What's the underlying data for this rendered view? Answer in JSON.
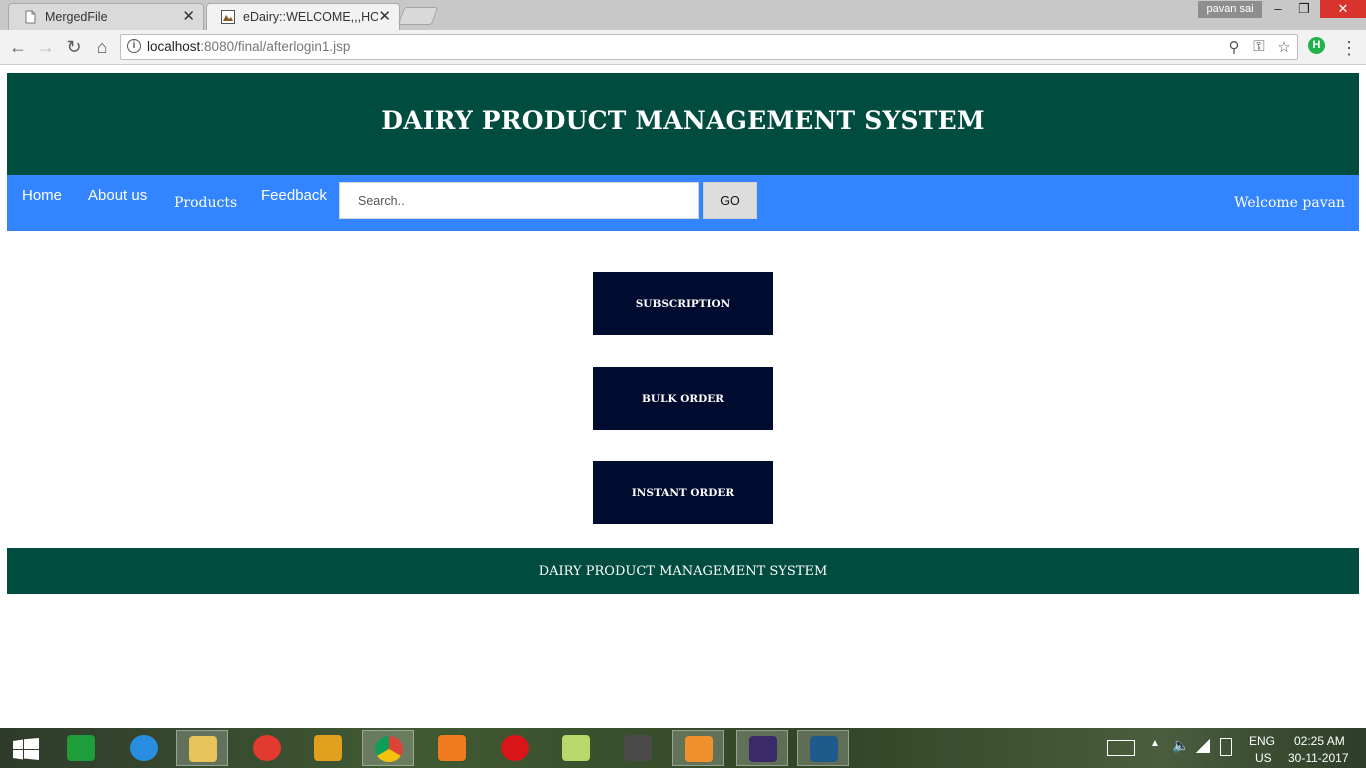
{
  "browser": {
    "tabs": [
      {
        "title": "MergedFile",
        "active": false
      },
      {
        "title": "eDairy::WELCOME,,,HOME",
        "active": true
      }
    ],
    "profile_name": "pavan sai",
    "url_host": "localhost",
    "url_path": ":8080/final/afterlogin1.jsp",
    "window_controls": {
      "minimize": "–",
      "restore": "❐",
      "close": "✕"
    },
    "icons": {
      "back": "←",
      "forward": "→",
      "reload": "↻",
      "home": "⌂",
      "zoom": "⚲",
      "key": "⚿",
      "star": "☆",
      "ext": "H",
      "menu": "⋮"
    }
  },
  "header": {
    "title": "DAIRY PRODUCT MANAGEMENT SYSTEM"
  },
  "nav": {
    "home": "Home",
    "about": "About us",
    "products": "Products",
    "feedback": "Feedback",
    "search_placeholder": "Search..",
    "go_label": "GO",
    "welcome": "Welcome pavan"
  },
  "actions": {
    "subscription": "SUBSCRIPTION",
    "bulk_order": "BULK ORDER",
    "instant_order": "INSTANT ORDER"
  },
  "footer": {
    "text": "DAIRY PRODUCT MANAGEMENT SYSTEM"
  },
  "taskbar": {
    "language_top": "ENG",
    "language_bottom": "US",
    "time": "02:25 AM",
    "date": "30-11-2017"
  },
  "colors": {
    "header_bg": "#004c3e",
    "nav_bg": "#3385ff",
    "button_bg": "#000b30"
  }
}
